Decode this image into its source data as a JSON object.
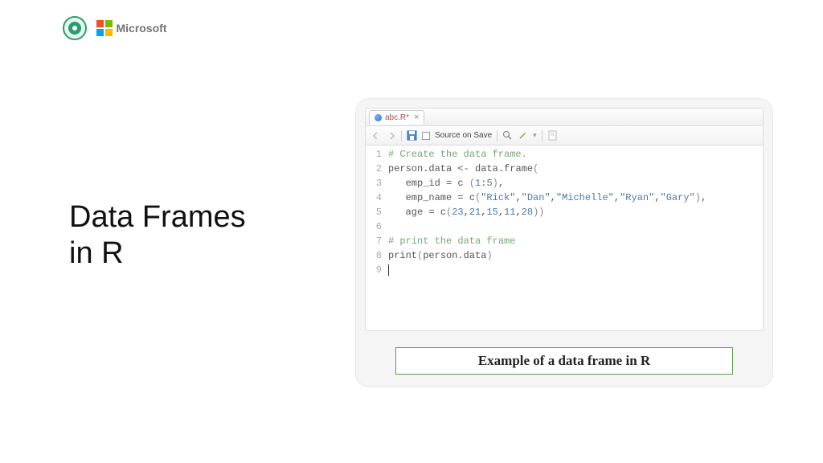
{
  "header": {
    "ms_text": "Microsoft"
  },
  "title": {
    "line1": "Data Frames",
    "line2": "in R"
  },
  "editor": {
    "tab_name": "abc.R*",
    "source_on_save": "Source on Save",
    "gutter": [
      "1",
      "2",
      "3",
      "4",
      "5",
      "6",
      "7",
      "8",
      "9"
    ],
    "code": {
      "l1_comment": "# Create the data frame.",
      "l2_a": "person.data ",
      "l2_op": "<-",
      "l2_b": " data.frame",
      "l2_p": "(",
      "l3_a": "   emp_id ",
      "l3_eq": "=",
      "l3_b": " c ",
      "l3_p1": "(",
      "l3_n1": "1",
      "l3_colon": ":",
      "l3_n2": "5",
      "l3_p2": ")",
      "l3_comma": ",",
      "l4_a": "   emp_name ",
      "l4_eq": "=",
      "l4_b": " c",
      "l4_p1": "(",
      "l4_s1": "\"Rick\"",
      "l4_c1": ",",
      "l4_s2": "\"Dan\"",
      "l4_c2": ",",
      "l4_s3": "\"Michelle\"",
      "l4_c3": ",",
      "l4_s4": "\"Ryan\"",
      "l4_c4": ",",
      "l4_s5": "\"Gary\"",
      "l4_p2": ")",
      "l4_comma": ",",
      "l5_a": "   age ",
      "l5_eq": "=",
      "l5_b": " c",
      "l5_p1": "(",
      "l5_n1": "23",
      "l5_c1": ",",
      "l5_n2": "21",
      "l5_c2": ",",
      "l5_n3": "15",
      "l5_c3": ",",
      "l5_n4": "11",
      "l5_c4": ",",
      "l5_n5": "28",
      "l5_p2": "))",
      "l7_comment": "# print the data frame",
      "l8_a": "print",
      "l8_p1": "(",
      "l8_b": "person.data",
      "l8_p2": ")"
    }
  },
  "caption": "Example of a data frame in R"
}
